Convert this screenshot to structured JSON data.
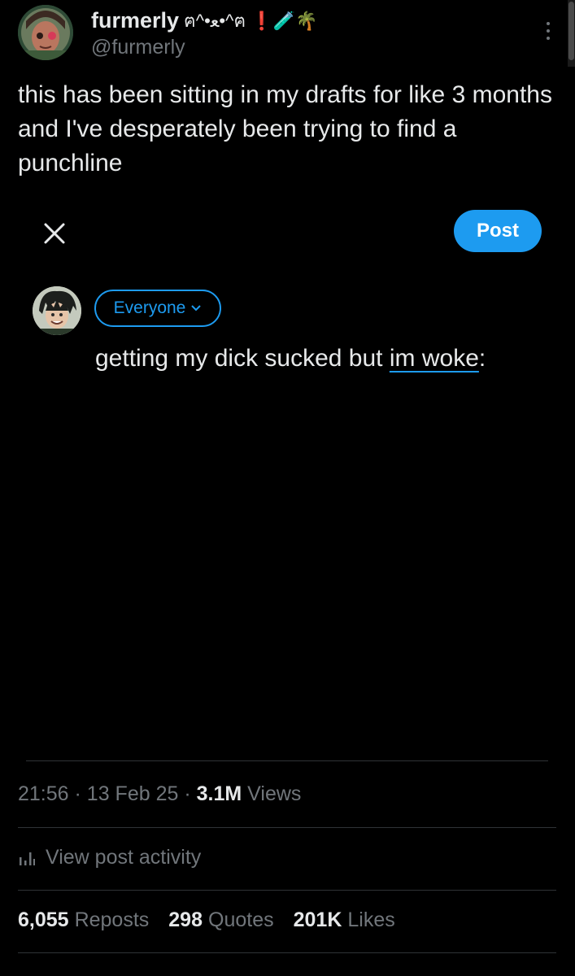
{
  "author": {
    "display_name": "furmerly",
    "name_emoji": "ฅ^•ﻌ•^ฅ ❗🧪🌴",
    "handle": "@furmerly"
  },
  "tweet": {
    "text": "this has been sitting in my drafts for like 3 months and I've desperately been trying to find a punchline"
  },
  "draft": {
    "post_label": "Post",
    "audience_label": "Everyone",
    "text_before": "getting my dick sucked but ",
    "text_link": "im woke",
    "text_after": ":"
  },
  "meta": {
    "time": "21:56",
    "date": "13 Feb 25",
    "views_count": "3.1M",
    "views_label": "Views"
  },
  "activity": {
    "label": "View post activity"
  },
  "stats": {
    "reposts_count": "6,055",
    "reposts_label": "Reposts",
    "quotes_count": "298",
    "quotes_label": "Quotes",
    "likes_count": "201K",
    "likes_label": "Likes"
  },
  "colors": {
    "background": "#000000",
    "accent": "#1d9bf0",
    "text_primary": "#e7e9ea",
    "text_secondary": "#71767b",
    "divider": "#2f3336"
  },
  "icons": [
    "more-vertical-icon",
    "close-icon",
    "chevron-down-icon",
    "analytics-bars-icon"
  ]
}
